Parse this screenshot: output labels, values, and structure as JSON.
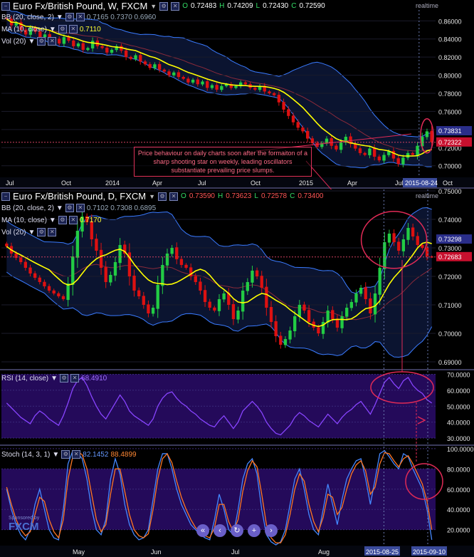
{
  "weekly": {
    "title": "Euro Fx/British Pound, W, FXCM",
    "ohlc": {
      "o_label": "O",
      "o": "0.72483",
      "h_label": "H",
      "h": "0.74209",
      "l_label": "L",
      "l": "0.72430",
      "c_label": "C",
      "c": "0.72590"
    },
    "bb_label": "BB (20, close, 2)",
    "bb_values": "0.7165  0.7370  0.6960",
    "ma_label": "MA (10, close)",
    "ma_value": "0.7110",
    "vol_label": "Vol (20)",
    "realtime": "realtime",
    "price_tag_1": "0.73831",
    "price_tag_2": "0.72322",
    "date_tag": "2015-08-24",
    "annotation": "Price behaviour on daily charts soon after the formaiton of a sharp shooting star on weekly, leading oscillators substantiate prevailing price slumps."
  },
  "daily": {
    "title": "Euro Fx/British Pound, D, FXCM",
    "ohlc": {
      "o_label": "O",
      "o": "0.73590",
      "h_label": "H",
      "h": "0.73623",
      "l_label": "L",
      "l": "0.72578",
      "c_label": "C",
      "c": "0.73400"
    },
    "bb_label": "BB (20, close, 2)",
    "bb_values": "0.7102  0.7308  0.6895",
    "ma_label": "MA (10, close)",
    "ma_value": "0.7170",
    "vol_label": "Vol (20)",
    "realtime": "realtime",
    "price_tag_1": "0.73298",
    "price_tag_2": "0.72683"
  },
  "rsi": {
    "label": "RSI (14, close)",
    "value": "68.4910"
  },
  "stoch": {
    "label": "Stoch (14, 3, 1)",
    "k": "82.1452",
    "d": "88.4899"
  },
  "bottom_dates": {
    "left": "2015-08-25",
    "right": "2015-09-10"
  },
  "brand": {
    "sponsor": "Sponsored by",
    "name": "FXCM"
  },
  "controls": [
    "«",
    "‹",
    "↻",
    "+",
    "›"
  ],
  "colors": {
    "bull": "#22cc44",
    "bear": "#dd1111",
    "ma": "#ffff00",
    "bb": "#3a7bff",
    "rsi": "#8844ff",
    "stoch_k": "#4488ff",
    "stoch_d": "#ff7722",
    "panel_fill": "#240a5a"
  },
  "chart_data": [
    {
      "type": "candlestick",
      "title": "Euro Fx/British Pound, W, FXCM",
      "x_ticks": [
        "Jul",
        "Oct",
        "2014",
        "Apr",
        "Jul",
        "Oct",
        "2015",
        "Apr",
        "Jul",
        "Oct"
      ],
      "y_ticks": [
        "0.86000",
        "0.84000",
        "0.82000",
        "0.80000",
        "0.78000",
        "0.76000",
        "0.74000",
        "0.72000",
        "0.70000"
      ],
      "ylim": [
        0.688,
        0.872
      ],
      "close": [
        0.862,
        0.855,
        0.858,
        0.85,
        0.845,
        0.852,
        0.848,
        0.842,
        0.845,
        0.838,
        0.84,
        0.835,
        0.842,
        0.838,
        0.832,
        0.835,
        0.828,
        0.83,
        0.838,
        0.832,
        0.83,
        0.825,
        0.828,
        0.832,
        0.827,
        0.82,
        0.818,
        0.822,
        0.815,
        0.812,
        0.808,
        0.812,
        0.806,
        0.804,
        0.8,
        0.803,
        0.798,
        0.796,
        0.792,
        0.795,
        0.79,
        0.793,
        0.786,
        0.789,
        0.784,
        0.788,
        0.79,
        0.786,
        0.788,
        0.792,
        0.79,
        0.786,
        0.784,
        0.788,
        0.782,
        0.78,
        0.778,
        0.77,
        0.762,
        0.755,
        0.748,
        0.742,
        0.738,
        0.73,
        0.725,
        0.721,
        0.725,
        0.73,
        0.722,
        0.718,
        0.726,
        0.732,
        0.724,
        0.719,
        0.714,
        0.712,
        0.719,
        0.71,
        0.706,
        0.712,
        0.716,
        0.708,
        0.702,
        0.709,
        0.714,
        0.712,
        0.722,
        0.732,
        0.738,
        0.7259
      ]
    },
    {
      "type": "candlestick",
      "title": "Euro Fx/British Pound, D, FXCM",
      "x_ticks": [
        "May",
        "Jun",
        "Jul",
        "Aug",
        "2015-08-25",
        "2015-09-10"
      ],
      "y_ticks": [
        "0.75000",
        "0.74000",
        "0.73000",
        "0.72000",
        "0.71000",
        "0.70000",
        "0.69000"
      ],
      "ylim": [
        0.6875,
        0.7505
      ],
      "close": [
        0.7305,
        0.728,
        0.7265,
        0.725,
        0.723,
        0.721,
        0.7195,
        0.718,
        0.7165,
        0.715,
        0.714,
        0.713,
        0.712,
        0.7175,
        0.727,
        0.736,
        0.741,
        0.739,
        0.733,
        0.729,
        0.723,
        0.718,
        0.7205,
        0.725,
        0.731,
        0.728,
        0.72,
        0.715,
        0.713,
        0.71,
        0.707,
        0.709,
        0.717,
        0.724,
        0.728,
        0.73,
        0.726,
        0.724,
        0.723,
        0.72,
        0.718,
        0.715,
        0.711,
        0.709,
        0.708,
        0.712,
        0.714,
        0.71,
        0.705,
        0.708,
        0.715,
        0.718,
        0.722,
        0.72,
        0.716,
        0.709,
        0.704,
        0.699,
        0.696,
        0.698,
        0.701,
        0.706,
        0.71,
        0.708,
        0.704,
        0.702,
        0.7,
        0.704,
        0.708,
        0.705,
        0.702,
        0.706,
        0.709,
        0.711,
        0.714,
        0.716,
        0.712,
        0.707,
        0.714,
        0.723,
        0.732,
        0.735,
        0.732,
        0.729,
        0.733,
        0.737,
        0.734,
        0.731,
        0.73,
        0.727,
        0.7268
      ]
    },
    {
      "type": "line",
      "title": "RSI (14, close)",
      "y_ticks": [
        "70.0000",
        "60.0000",
        "50.0000",
        "40.0000",
        "30.0000"
      ],
      "ylim": [
        26,
        72
      ],
      "values": [
        52,
        49,
        46,
        43,
        41,
        39,
        44,
        47,
        45,
        42,
        40,
        38,
        44,
        52,
        61,
        66,
        68,
        63,
        56,
        50,
        45,
        42,
        47,
        52,
        57,
        53,
        47,
        44,
        42,
        40,
        38,
        42,
        50,
        55,
        58,
        59,
        55,
        52,
        50,
        47,
        45,
        42,
        40,
        38,
        37,
        41,
        44,
        40,
        36,
        40,
        47,
        50,
        53,
        50,
        46,
        40,
        36,
        33,
        32,
        35,
        38,
        43,
        46,
        44,
        41,
        39,
        37,
        41,
        45,
        42,
        39,
        43,
        46,
        48,
        51,
        53,
        49,
        45,
        51,
        58,
        65,
        68,
        64,
        61,
        66,
        68,
        63,
        60,
        58,
        54,
        52
      ]
    },
    {
      "type": "line",
      "title": "Stoch (14, 3, 1)",
      "y_ticks": [
        "100.0000",
        "80.0000",
        "60.0000",
        "40.0000",
        "20.0000"
      ],
      "ylim": [
        5,
        102
      ],
      "series": [
        {
          "name": "%K",
          "values": [
            60,
            40,
            25,
            15,
            10,
            20,
            45,
            60,
            40,
            20,
            12,
            10,
            40,
            85,
            98,
            96,
            90,
            70,
            40,
            20,
            15,
            30,
            70,
            90,
            75,
            45,
            25,
            15,
            10,
            12,
            20,
            50,
            80,
            95,
            95,
            80,
            60,
            45,
            35,
            25,
            20,
            15,
            12,
            10,
            30,
            55,
            40,
            20,
            15,
            40,
            70,
            85,
            90,
            75,
            40,
            15,
            8,
            5,
            8,
            20,
            45,
            70,
            80,
            60,
            35,
            20,
            15,
            40,
            65,
            45,
            25,
            50,
            70,
            80,
            88,
            90,
            70,
            45,
            70,
            95,
            98,
            92,
            85,
            80,
            95,
            92,
            80,
            70,
            60,
            40,
            10
          ]
        },
        {
          "name": "%D",
          "values": [
            62,
            45,
            30,
            20,
            14,
            18,
            35,
            52,
            48,
            30,
            18,
            12,
            30,
            70,
            92,
            97,
            94,
            80,
            55,
            30,
            18,
            25,
            55,
            80,
            80,
            58,
            35,
            20,
            14,
            12,
            16,
            40,
            70,
            90,
            95,
            86,
            68,
            52,
            40,
            30,
            22,
            18,
            14,
            12,
            22,
            45,
            45,
            28,
            18,
            30,
            58,
            78,
            88,
            82,
            55,
            25,
            12,
            7,
            7,
            15,
            35,
            60,
            75,
            68,
            45,
            28,
            18,
            32,
            55,
            52,
            35,
            42,
            60,
            75,
            84,
            88,
            78,
            55,
            62,
            85,
            96,
            95,
            88,
            82,
            90,
            93,
            85,
            75,
            65,
            48,
            20
          ]
        }
      ]
    }
  ]
}
